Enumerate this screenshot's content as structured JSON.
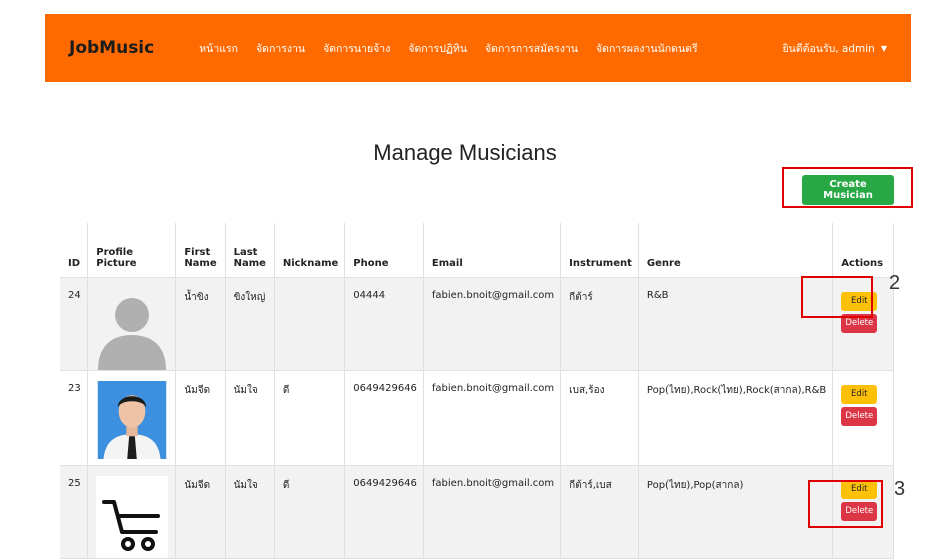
{
  "navbar": {
    "brand": "JobMusic",
    "links": [
      "หน้าแรก",
      "จัดการงาน",
      "จัดการนายจ้าง",
      "จัดการปฏิทิน",
      "จัดการการสมัครงาน",
      "จัดการผลงานนักดนตรี"
    ],
    "user_label": "ยินดีต้อนรับ, admin"
  },
  "page": {
    "title": "Manage Musicians",
    "create_label": "Create Musician"
  },
  "table": {
    "headers": {
      "id": "ID",
      "profile": "Profile Picture",
      "first": "First Name",
      "last": "Last Name",
      "nickname": "Nickname",
      "phone": "Phone",
      "email": "Email",
      "instrument": "Instrument",
      "genre": "Genre",
      "actions": "Actions"
    },
    "rows": [
      {
        "id": "24",
        "first": "น้ำขิง",
        "last": "ขิงใหญ่",
        "nickname": "",
        "phone": "04444",
        "email": "fabien.bnoit@gmail.com",
        "instrument": "กีต้าร์",
        "genre": "R&B",
        "picture": "default-avatar"
      },
      {
        "id": "23",
        "first": "นัมจีด",
        "last": "นัมใจ",
        "nickname": "ดี",
        "phone": "0649429646",
        "email": "fabien.bnoit@gmail.com",
        "instrument": "เบส,ร้อง",
        "genre": "Pop(ไทย),Rock(ไทย),Rock(สากล),R&B",
        "picture": "person-photo"
      },
      {
        "id": "25",
        "first": "นัมจีด",
        "last": "นัมใจ",
        "nickname": "ดี",
        "phone": "0649429646",
        "email": "fabien.bnoit@gmail.com",
        "instrument": "กีต้าร์,เบส",
        "genre": "Pop(ไทย),Pop(สากล)",
        "picture": "cart-icon"
      }
    ],
    "edit_label": "Edit",
    "delete_label": "Delete"
  },
  "annotations": {
    "marker_2": "2",
    "marker_3": "3",
    "highlight_color": "#e00000"
  },
  "colors": {
    "navbar": "#ff6a00",
    "create": "#28a745",
    "edit": "#ffc107",
    "delete": "#dc3545"
  }
}
